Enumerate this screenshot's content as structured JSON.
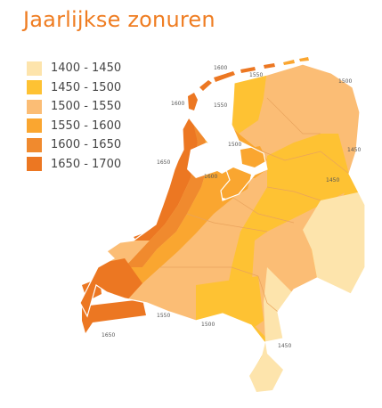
{
  "title": "Jaarlijkse zonuren",
  "legend": [
    {
      "label": "1400 - 1450",
      "color": "#fde4ac"
    },
    {
      "label": "1450 - 1500",
      "color": "#fec233"
    },
    {
      "label": "1500 - 1550",
      "color": "#fbbd75"
    },
    {
      "label": "1550 - 1600",
      "color": "#faa630"
    },
    {
      "label": "1600 - 1650",
      "color": "#f08a2e"
    },
    {
      "label": "1650 - 1700",
      "color": "#ec7722"
    }
  ],
  "map_labels": [
    "1600",
    "1550",
    "1600",
    "1550",
    "1500",
    "1500",
    "1450",
    "1650",
    "1600",
    "1450",
    "1550",
    "1650",
    "1500",
    "1450"
  ],
  "colors": {
    "border": "#ffffff",
    "province_line": "#e9a35c",
    "title": "#ef7d22"
  }
}
